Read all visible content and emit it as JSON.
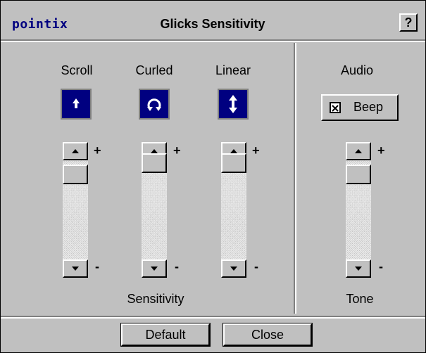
{
  "window": {
    "brand": "pointix",
    "title": "Glicks Sensitivity",
    "help_label": "?"
  },
  "sensitivity": {
    "columns": [
      {
        "label": "Scroll",
        "icon": "scroll-arrow-icon",
        "level": 0.85
      },
      {
        "label": "Curled",
        "icon": "curled-arrow-icon",
        "level": 0.85
      },
      {
        "label": "Linear",
        "icon": "linear-arrow-icon",
        "level": 0.85
      }
    ],
    "footer_label": "Sensitivity",
    "plus": "+",
    "minus": "-"
  },
  "audio": {
    "label": "Audio",
    "beep_label": "Beep",
    "beep_checked": true,
    "tone_label": "Tone",
    "tone_level": 0.85,
    "plus": "+",
    "minus": "-"
  },
  "buttons": {
    "default_label": "Default",
    "close_label": "Close"
  },
  "colors": {
    "face": "#c0c0c0",
    "icon_bg": "#000080",
    "brand": "#000080"
  }
}
